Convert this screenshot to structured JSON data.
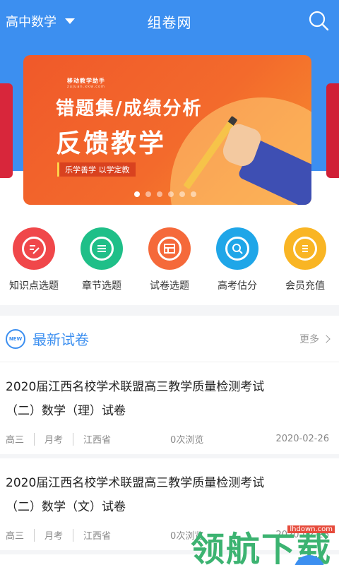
{
  "header": {
    "subject": "高中数学",
    "title": "组卷网",
    "search_icon": "search-icon"
  },
  "banner": {
    "small_text": "移动教学助手",
    "url_text": "zujuan.xkw.com",
    "line1": "错题集/成绩分析",
    "line2": "反馈教学",
    "tag": "乐学善学 以学定教",
    "slides": 6,
    "active_slide": 0
  },
  "nav": [
    {
      "label": "知识点选题",
      "icon": "edit-icon",
      "color": "#f0474a"
    },
    {
      "label": "章节选题",
      "icon": "book-icon",
      "color": "#1fbf88"
    },
    {
      "label": "试卷选题",
      "icon": "paper-icon",
      "color": "#f5693a"
    },
    {
      "label": "高考估分",
      "icon": "search-icon",
      "color": "#1fa6e8"
    },
    {
      "label": "会员充值",
      "icon": "card-icon",
      "color": "#f9b524"
    }
  ],
  "latest": {
    "badge": "NEW",
    "title": "最新试卷",
    "more": "更多",
    "papers": [
      {
        "title_line1": "2020届江西名校学术联盟高三教学质量检测考试",
        "title_line2": "（二）数学（理）试卷",
        "grade": "高三",
        "type": "月考",
        "region": "江西省",
        "views": "0次浏览",
        "date": "2020-02-26"
      },
      {
        "title_line1": "2020届江西名校学术联盟高三教学质量检测考试",
        "title_line2": "（二）数学（文）试卷",
        "grade": "高三",
        "type": "月考",
        "region": "江西省",
        "views": "0次浏览",
        "date": "2020-02-26"
      }
    ]
  },
  "watermark": {
    "logo": "领航下载",
    "site": "lhdown.com"
  },
  "colors": {
    "primary": "#3c8ff0",
    "banner": "#f36a2c"
  }
}
